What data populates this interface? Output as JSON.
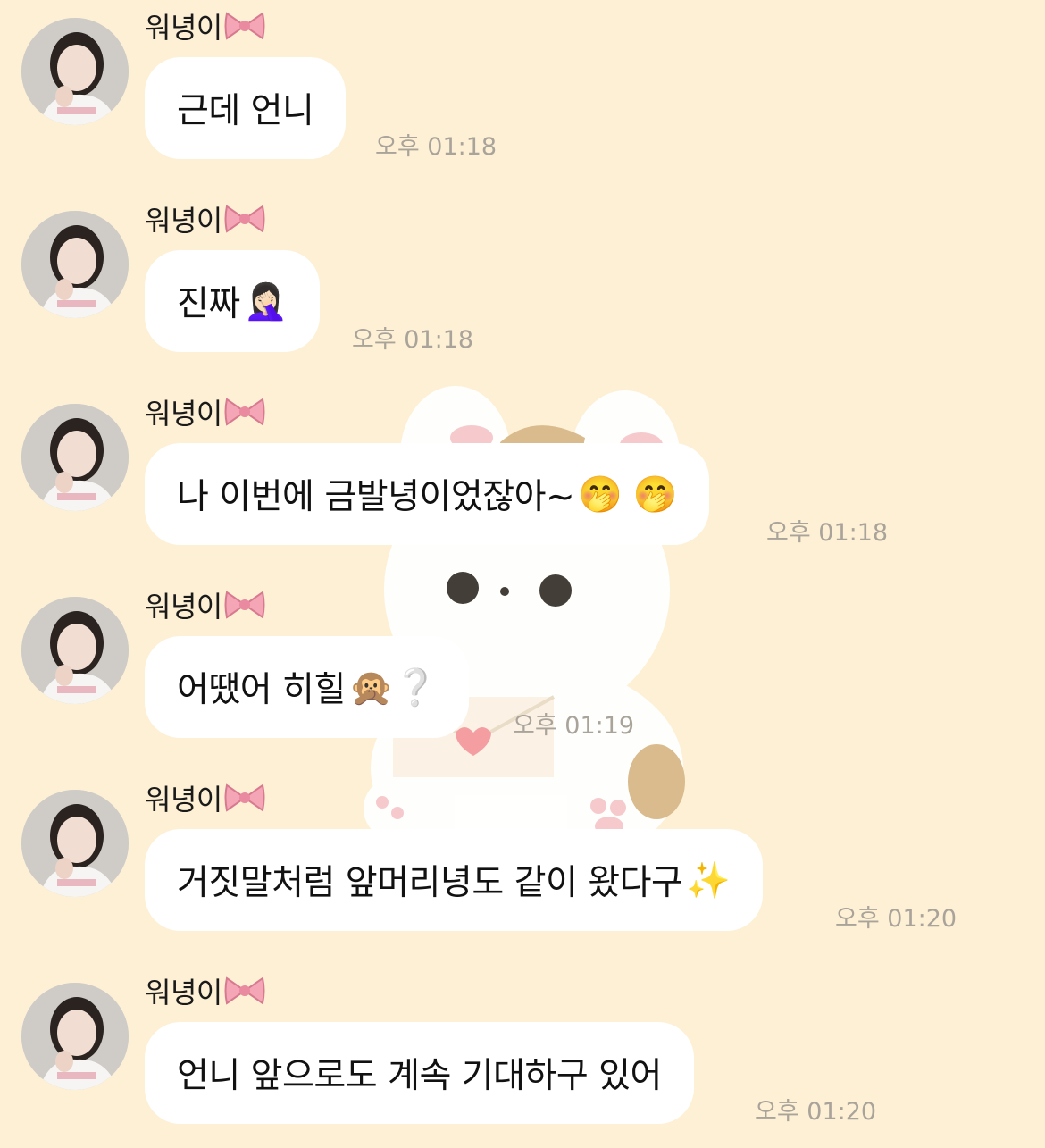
{
  "chat": {
    "messages": [
      {
        "sender": "워녕이",
        "sender_emoji": "🎀",
        "text": "근데 언니",
        "emoji": "",
        "time": "오후 01:18"
      },
      {
        "sender": "워녕이",
        "sender_emoji": "🎀",
        "text": "진짜",
        "emoji": "🤦🏻‍♀️",
        "time": "오후 01:18"
      },
      {
        "sender": "워녕이",
        "sender_emoji": "🎀",
        "text": "나 이번에 금발녕이었잖아~",
        "emoji": "🤭 🤭",
        "time": "오후 01:18"
      },
      {
        "sender": "워녕이",
        "sender_emoji": "🎀",
        "text": "어땠어 히힐",
        "emoji": "🙊❔",
        "time": "오후 01:19"
      },
      {
        "sender": "워녕이",
        "sender_emoji": "🎀",
        "text": "거짓말처럼 앞머리녕도 같이 왔다구",
        "emoji": "✨",
        "time": "오후 01:20"
      },
      {
        "sender": "워녕이",
        "sender_emoji": "🎀",
        "text": "언니 앞으로도 계속 기대하구 있어",
        "emoji": "",
        "time": "오후 01:20"
      }
    ]
  },
  "theme": {
    "background": "#fdf0d5",
    "bubble": "#ffffff",
    "time_color": "#a9a39a"
  }
}
